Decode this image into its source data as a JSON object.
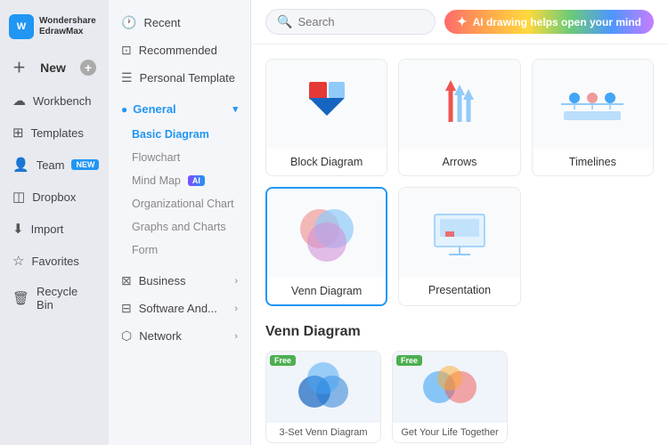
{
  "brand": {
    "short": "W",
    "line1": "Wondershare",
    "line2": "EdrawMax"
  },
  "sidebar": {
    "new_label": "New",
    "workbench_label": "Workbench",
    "templates_label": "Templates",
    "team_label": "Team",
    "team_badge": "NEW",
    "dropbox_label": "Dropbox",
    "import_label": "Import",
    "favorites_label": "Favorites",
    "recycle_label": "Recycle Bin"
  },
  "middle": {
    "recent_label": "Recent",
    "recommended_label": "Recommended",
    "personal_label": "Personal Template",
    "general_label": "General",
    "basic_diagram_label": "Basic Diagram",
    "flowchart_label": "Flowchart",
    "mind_map_label": "Mind Map",
    "org_chart_label": "Organizational Chart",
    "graphs_label": "Graphs and Charts",
    "form_label": "Form",
    "business_label": "Business",
    "software_label": "Software And...",
    "network_label": "Network"
  },
  "header": {
    "search_placeholder": "Search",
    "ai_banner_text": "AI drawing helps open your mind"
  },
  "templates": [
    {
      "name": "Block Diagram",
      "type": "block"
    },
    {
      "name": "Arrows",
      "type": "arrows"
    },
    {
      "name": "Timelines",
      "type": "timelines"
    },
    {
      "name": "Venn Diagram",
      "type": "venn",
      "selected": true
    },
    {
      "name": "Presentation",
      "type": "presentation"
    }
  ],
  "venn_section": {
    "title": "Venn Diagram",
    "cards": [
      {
        "name": "3-Set Venn Diagram",
        "free": true
      },
      {
        "name": "Get Your Life Together",
        "free": true
      }
    ]
  }
}
